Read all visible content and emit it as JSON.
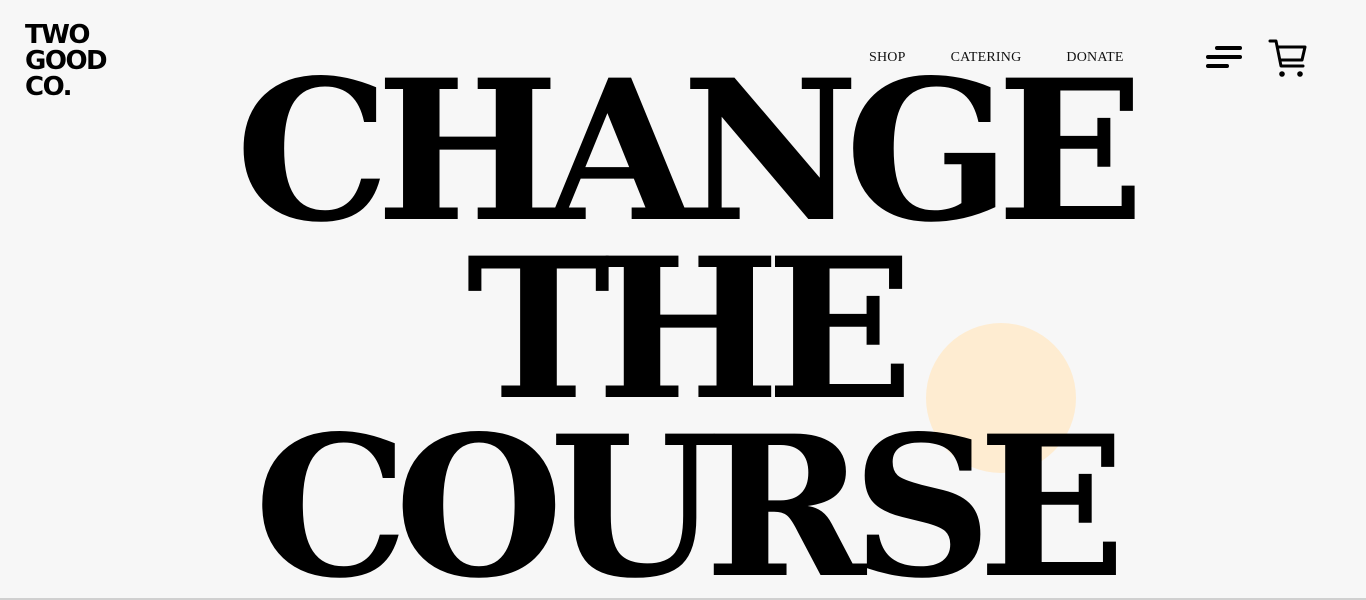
{
  "brand": {
    "logo_lines": [
      "TWO",
      "GOOD",
      "CO."
    ]
  },
  "nav": {
    "items": [
      {
        "label": "SHOP"
      },
      {
        "label": "CATERING"
      },
      {
        "label": "DONATE"
      }
    ]
  },
  "icons": {
    "menu": "menu-icon",
    "cart": "cart-icon"
  },
  "hero": {
    "lines": [
      "CHANGE",
      "THE",
      "COURSE"
    ]
  },
  "colors": {
    "background": "#f7f7f7",
    "text": "#000000",
    "accent_circle": "#feecd1"
  }
}
